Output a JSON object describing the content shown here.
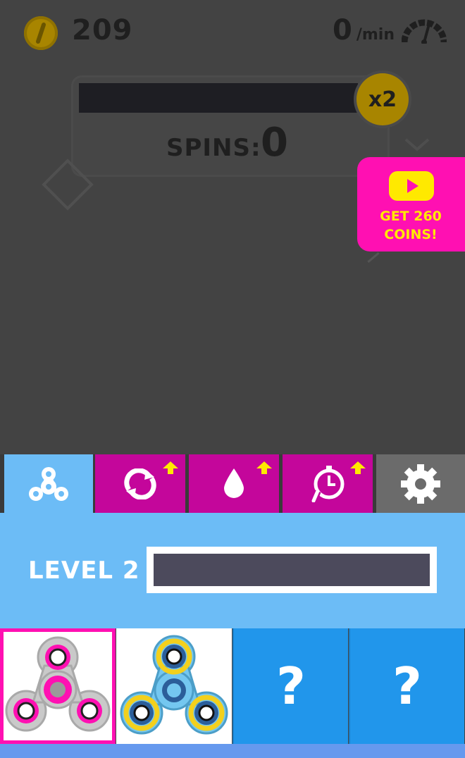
{
  "hud": {
    "coins": "209",
    "rate_value": "0",
    "rate_unit": "/min"
  },
  "spin_panel": {
    "multiplier": "x2",
    "spins_label": "SPINS:",
    "spins_value": "0",
    "progress": 0
  },
  "reward": {
    "line1": "GET 260",
    "line2": "COINS!"
  },
  "tabs": [
    {
      "name": "spinner",
      "icon": "fidget-spinner-icon",
      "active": true,
      "upgrade": false
    },
    {
      "name": "rotation",
      "icon": "rotate-arrows-icon",
      "active": false,
      "upgrade": true
    },
    {
      "name": "lubricant",
      "icon": "water-drop-icon",
      "active": false,
      "upgrade": true
    },
    {
      "name": "duration",
      "icon": "stopwatch-icon",
      "active": false,
      "upgrade": true
    },
    {
      "name": "settings",
      "icon": "gear-icon",
      "active": false,
      "upgrade": false
    }
  ],
  "level": {
    "label": "LEVEL 2",
    "progress": 0
  },
  "spinners": [
    {
      "state": "selected",
      "colors": {
        "body": "#c9c9c9",
        "accent": "#ff10b2"
      }
    },
    {
      "state": "owned",
      "colors": {
        "body": "#74c7f0",
        "accent": "#f3d01d"
      }
    },
    {
      "state": "locked",
      "label": "?"
    },
    {
      "state": "locked",
      "label": "?"
    }
  ],
  "colors": {
    "overlay": "#434343",
    "magenta": "#ff10b2",
    "tab_magenta": "#c4069b",
    "sky": "#6cbcf6",
    "locked_blue": "#2196eb",
    "yellow": "#ffe900"
  }
}
